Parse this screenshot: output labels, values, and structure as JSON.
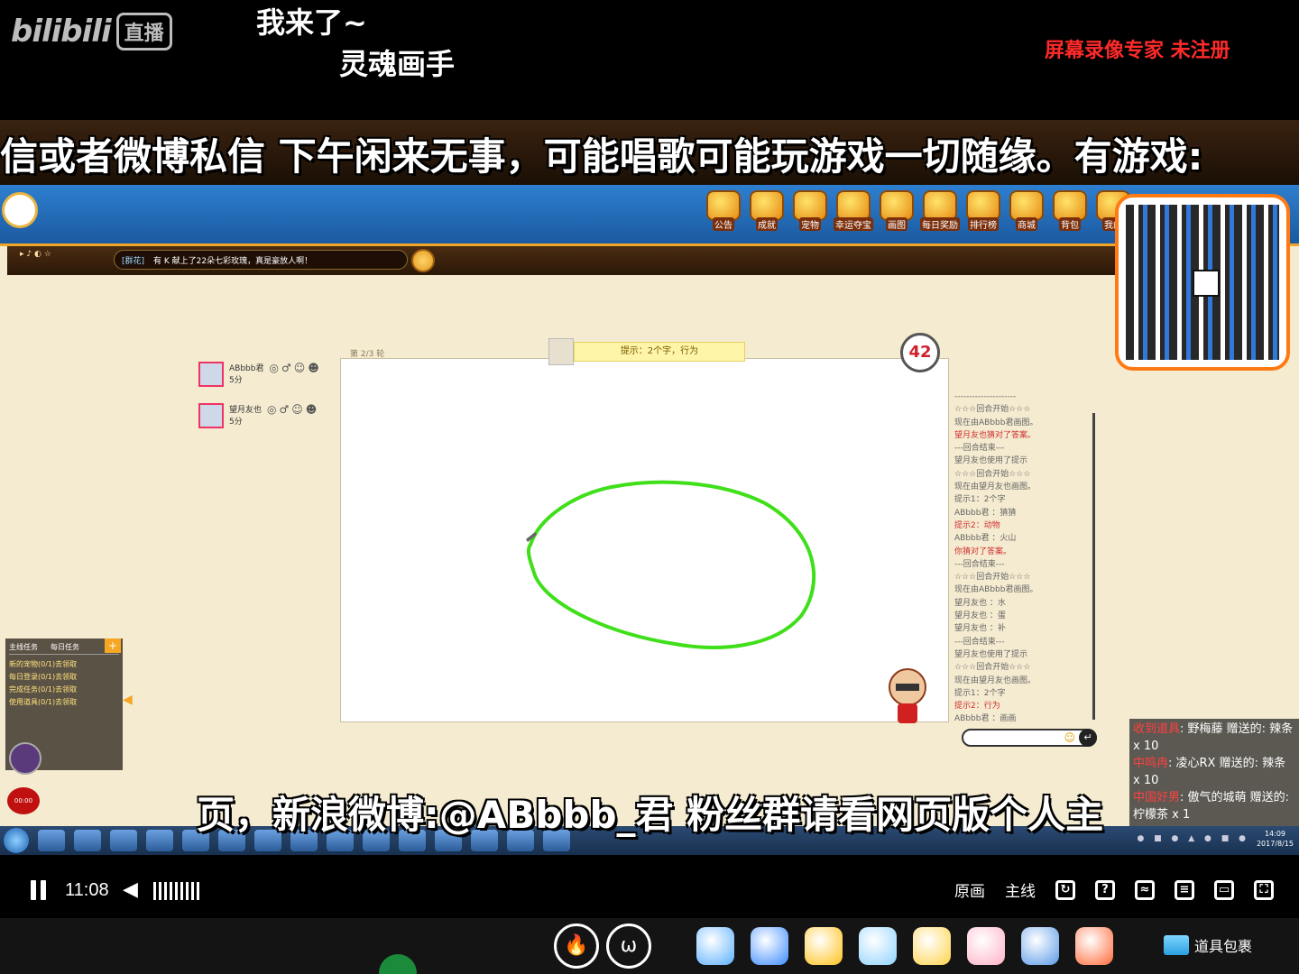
{
  "stream": {
    "logo_word": "bilibili",
    "logo_live": "直播",
    "danmaku": [
      "我来了~",
      "灵魂画手"
    ],
    "watermark": "屏幕录像专家  未注册"
  },
  "subtitles": {
    "top": "信或者微博私信 下午闲来无事，可能唱歌可能玩游戏一切随缘。有游戏:",
    "bottom": "页，新浪微博:@ABbbb_君 粉丝群请看网页版个人主"
  },
  "game": {
    "menu": [
      "公告",
      "成就",
      "宠物",
      "幸运夺宝",
      "画图",
      "每日奖励",
      "排行榜",
      "商城",
      "背包",
      "我的"
    ],
    "system_message_tag": "[群花]",
    "system_message": "有 K  献上了22朵七彩玫瑰，真是豪放人啊！",
    "round_label": "第 2/3 轮",
    "hint": "提示：2个字，行为",
    "timer": "42",
    "players": [
      {
        "name": "ABbbb君",
        "score": "5分"
      },
      {
        "name": "望月友也",
        "score": "5分"
      }
    ],
    "chat_log": [
      {
        "t": "---------------------",
        "red": false
      },
      {
        "t": "☆☆☆回合开始☆☆☆",
        "red": false
      },
      {
        "t": "现在由ABbbb君画图。",
        "red": false
      },
      {
        "t": "望月友也猜对了答案。",
        "red": true
      },
      {
        "t": "---回合结束---",
        "red": false
      },
      {
        "t": "望月友也使用了提示",
        "red": false
      },
      {
        "t": "☆☆☆回合开始☆☆☆",
        "red": false
      },
      {
        "t": "现在由望月友也画图。",
        "red": false
      },
      {
        "t": "提示1：2个字",
        "red": false
      },
      {
        "t": "ABbbb君 ：猜猜",
        "red": false
      },
      {
        "t": "提示2：动物",
        "red": true
      },
      {
        "t": "ABbbb君 ：火山",
        "red": false
      },
      {
        "t": "你猜对了答案。",
        "red": true
      },
      {
        "t": "---回合结束---",
        "red": false
      },
      {
        "t": "☆☆☆回合开始☆☆☆",
        "red": false
      },
      {
        "t": "现在由ABbbb君画图。",
        "red": false
      },
      {
        "t": "望月友也 ：水",
        "red": false
      },
      {
        "t": "望月友也 ：蛋",
        "red": false
      },
      {
        "t": "望月友也 ：补",
        "red": false
      },
      {
        "t": "---回合结束---",
        "red": false
      },
      {
        "t": "望月友也使用了提示",
        "red": false
      },
      {
        "t": "☆☆☆回合开始☆☆☆",
        "red": false
      },
      {
        "t": "现在由望月友也画图。",
        "red": false
      },
      {
        "t": "提示1：2个字",
        "red": false
      },
      {
        "t": "提示2：行为",
        "red": true
      },
      {
        "t": "ABbbb君 ：画画",
        "red": false
      }
    ],
    "tasks": {
      "tabs": [
        "主线任务",
        "每日任务"
      ],
      "items": [
        "新的宠物(0/1)去领取",
        "每日登录(0/1)去领取",
        "完成任务(0/1)去领取",
        "使用道具(0/1)去领取"
      ]
    },
    "clock": "14:09",
    "date": "2017/8/15"
  },
  "gifts": [
    {
      "name": "收到道具",
      "text": ": 野梅藤 赠送的: 辣条 x 10"
    },
    {
      "name": "中鸣冉",
      "text": ": 凌心RX 赠送的: 辣条 x 10"
    },
    {
      "name": "中国好男",
      "text": ": 傲气的城萌 赠送的: 柠檬茶 x 1"
    }
  ],
  "player": {
    "time": "11:08",
    "quality": "原画",
    "line": "主线"
  },
  "gift_bar": {
    "bag_label": "道具包裹",
    "colors": [
      "#5bb0ff",
      "#3d8cff",
      "#ffc21a",
      "#8fd3ff",
      "#ffd34a",
      "#ffb1c5",
      "#5a9ae8",
      "#ff6a3a"
    ]
  }
}
